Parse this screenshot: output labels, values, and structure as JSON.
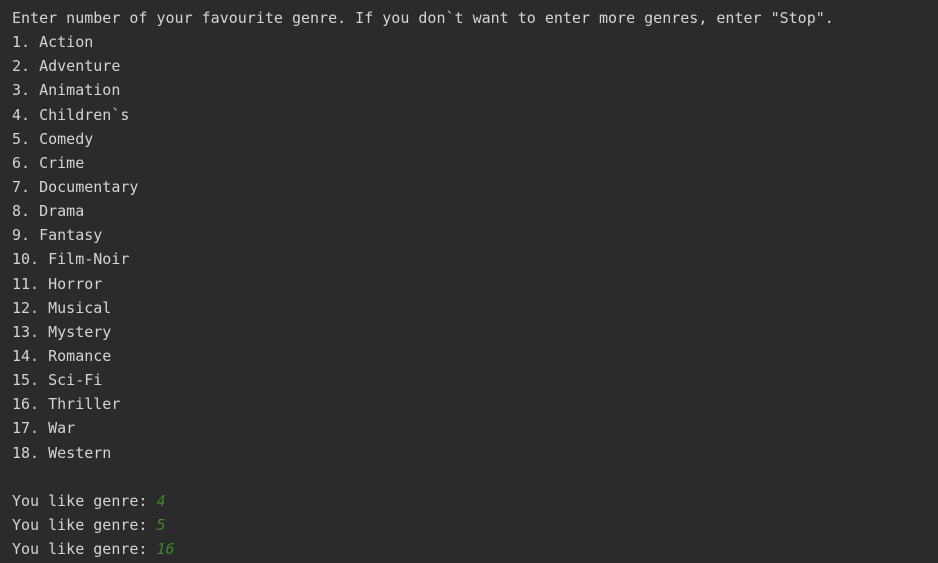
{
  "console": {
    "prompt": "Enter number of your favourite genre. If you don`t want to enter more genres, enter \"Stop\".",
    "genres": [
      "1. Action",
      "2. Adventure",
      "3. Animation",
      "4. Children`s",
      "5. Comedy",
      "6. Crime",
      "7. Documentary",
      "8. Drama",
      "9. Fantasy",
      "10. Film-Noir",
      "11. Horror",
      "12. Musical",
      "13. Mystery",
      "14. Romance",
      "15. Sci-Fi",
      "16. Thriller",
      "17. War",
      "18. Western"
    ],
    "responses": [
      {
        "label": "You like genre: ",
        "value": "4"
      },
      {
        "label": "You like genre: ",
        "value": "5"
      },
      {
        "label": "You like genre: ",
        "value": "16"
      }
    ]
  },
  "colors": {
    "background": "#2b2b2b",
    "text": "#d4d4d4",
    "input": "#3a8a2a"
  }
}
